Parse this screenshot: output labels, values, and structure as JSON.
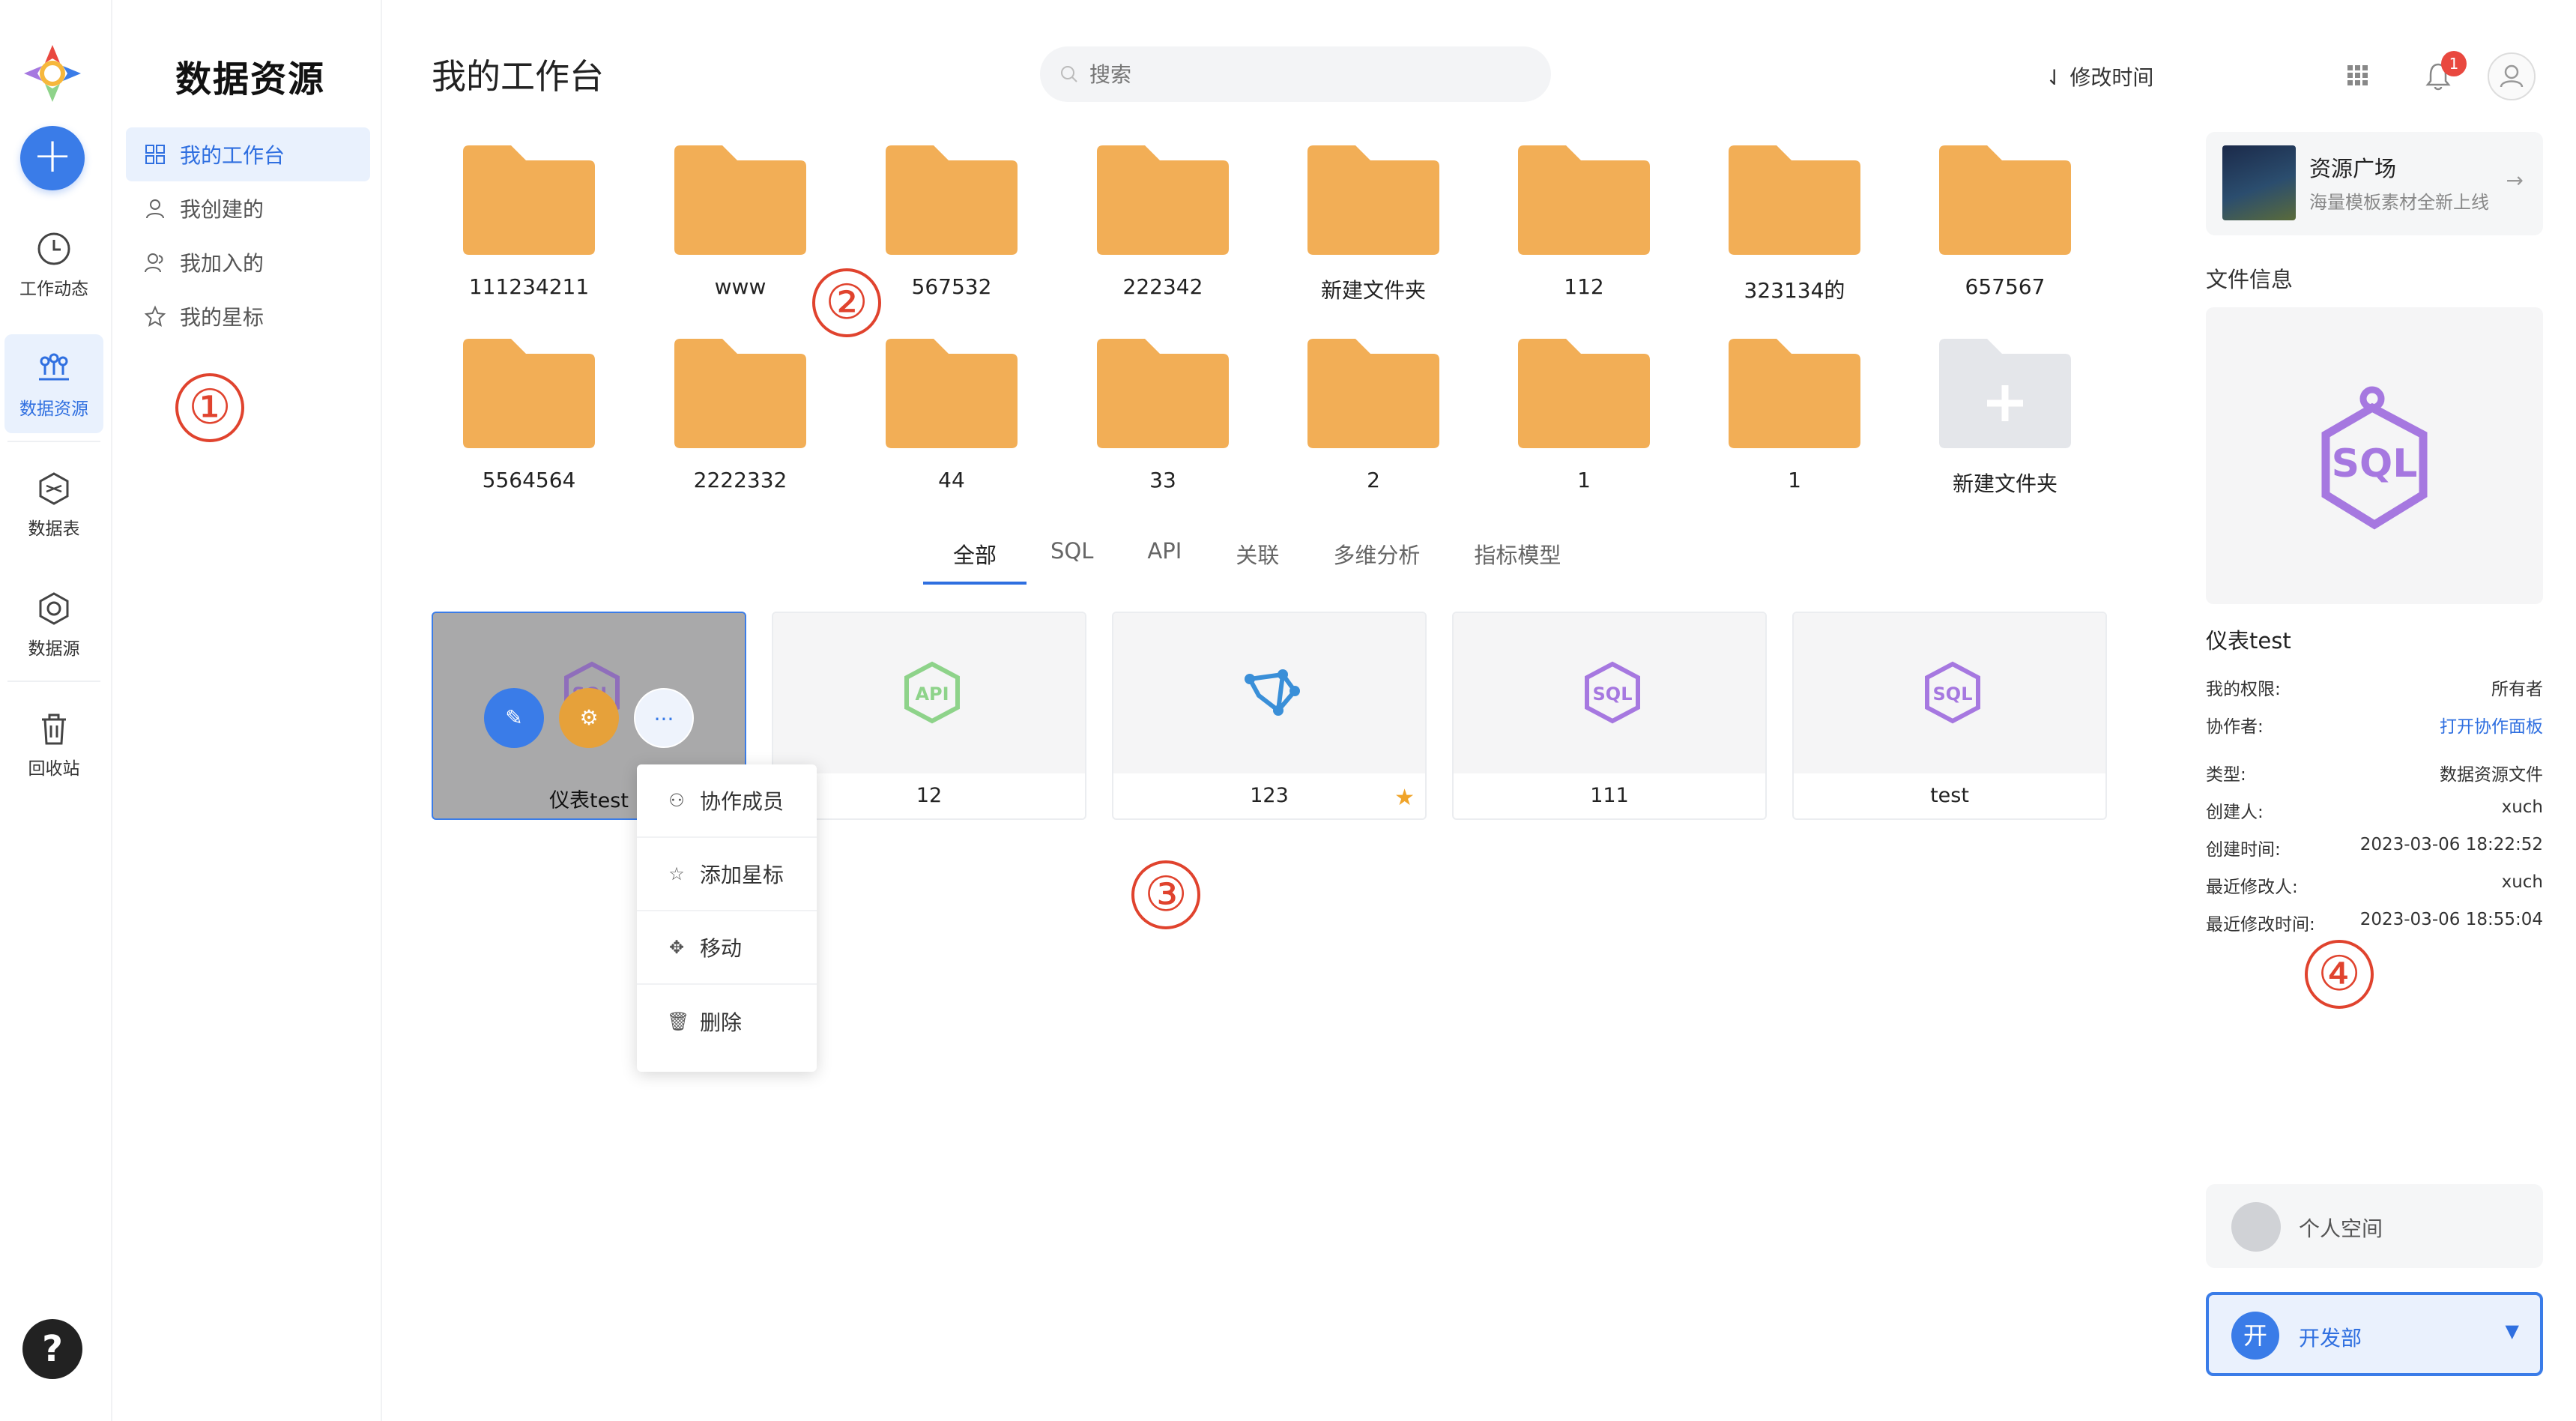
{
  "rail": {
    "items": [
      {
        "label": "工作动态",
        "icon": "clock-icon"
      },
      {
        "label": "数据资源",
        "icon": "data-resource-icon"
      },
      {
        "label": "数据表",
        "icon": "data-table-icon"
      },
      {
        "label": "数据源",
        "icon": "data-source-icon"
      },
      {
        "label": "回收站",
        "icon": "trash-icon"
      }
    ],
    "add_label": "+",
    "help_label": "?"
  },
  "sidebar": {
    "title": "数据资源",
    "items": [
      {
        "label": "我的工作台",
        "icon": "grid-icon",
        "active": true
      },
      {
        "label": "我创建的",
        "icon": "user-icon"
      },
      {
        "label": "我加入的",
        "icon": "users-icon"
      },
      {
        "label": "我的星标",
        "icon": "star-icon"
      }
    ]
  },
  "annotations": [
    "①",
    "②",
    "③",
    "④"
  ],
  "header": {
    "title": "我的工作台",
    "search_placeholder": "搜索",
    "sort_label": "修改时间",
    "notification_count": "1"
  },
  "folders": [
    "111234211",
    "www",
    "567532",
    "222342",
    "新建文件夹",
    "112",
    "323134的",
    "657567",
    "5564564",
    "2222332",
    "44",
    "33",
    "2",
    "1",
    "1"
  ],
  "new_folder_label": "新建文件夹",
  "tabs": [
    "全部",
    "SQL",
    "API",
    "关联",
    "多维分析",
    "指标模型"
  ],
  "cards": [
    {
      "label": "仪表test",
      "type": "sql",
      "selected": true
    },
    {
      "label": "12",
      "type": "api"
    },
    {
      "label": "123",
      "type": "relation",
      "starred": true
    },
    {
      "label": "111",
      "type": "sql"
    },
    {
      "label": "test",
      "type": "sql"
    }
  ],
  "context_menu": [
    {
      "label": "协作成员",
      "icon": "members-icon"
    },
    {
      "label": "添加星标",
      "icon": "star-icon"
    },
    {
      "label": "移动",
      "icon": "move-icon"
    },
    {
      "label": "删除",
      "icon": "trash-icon"
    }
  ],
  "resource": {
    "title": "资源广场",
    "subtitle": "海量模板素材全新上线"
  },
  "file_info": {
    "section_title": "文件信息",
    "name": "仪表test",
    "rows": [
      {
        "key": "我的权限:",
        "value": "所有者"
      },
      {
        "key": "协作者:",
        "value": "打开协作面板",
        "link": true
      },
      {
        "key": "类型:",
        "value": "数据资源文件"
      },
      {
        "key": "创建人:",
        "value": "xuch"
      },
      {
        "key": "创建时间:",
        "value": "2023-03-06 18:22:52"
      },
      {
        "key": "最近修改人:",
        "value": "xuch"
      },
      {
        "key": "最近修改时间:",
        "value": "2023-03-06 18:55:04"
      }
    ]
  },
  "workspace": {
    "personal_label": "个人空间",
    "dept_avatar": "开",
    "dept_label": "开发部"
  },
  "colors": {
    "accent": "#3a7ce8",
    "folder": "#f2ae56",
    "sql": "#a678e0",
    "api": "#8ed38a",
    "annotation": "#e0432e"
  }
}
